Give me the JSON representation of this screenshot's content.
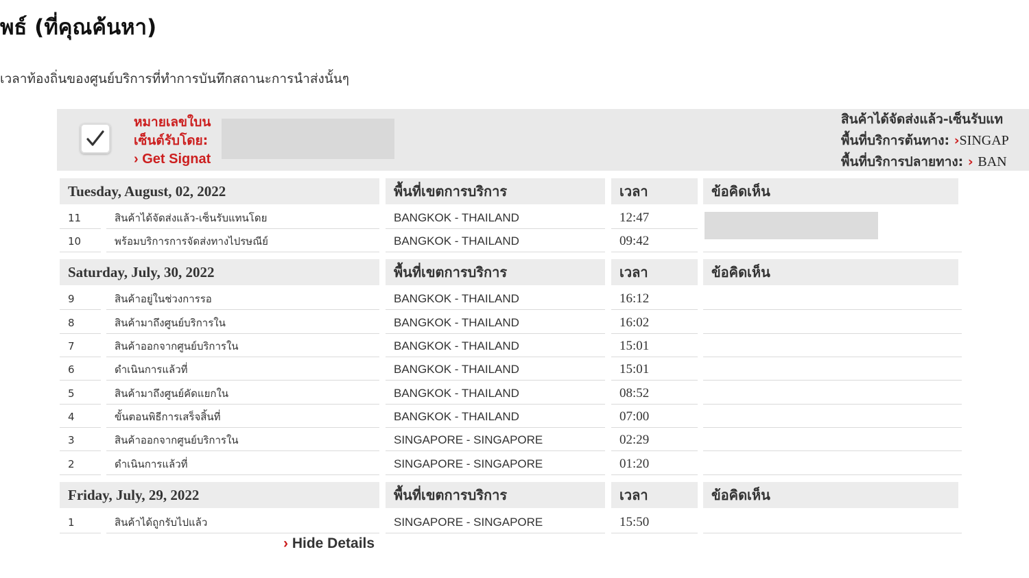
{
  "page": {
    "title": "พธ์ (ที่คุณค้นหา)",
    "subtitle": "เวลาท้องถิ่นของศูนย์บริการที่ทำการบันทึกสถานะการนำส่งนั้นๆ"
  },
  "summary": {
    "waybill_label": "หมายเลขใบน",
    "signed_by_label": "เซ็นต์รับโดย:",
    "signature_link": "Get Signat",
    "status_text": "สินค้าได้จัดส่งแล้ว-เซ็นรับแท",
    "origin_label": "พื้นที่บริการต้นทาง:",
    "origin_value": "SINGAP",
    "destination_label": "พื้นที่บริการปลายทาง:",
    "destination_value": "BAN",
    "colors": {
      "accent_red": "#cc1f1f",
      "header_gray": "#ececec",
      "summary_gray": "#e9e9e9"
    },
    "icons": [
      "checkmark-icon",
      "arrow-right-icon"
    ]
  },
  "table": {
    "headers": {
      "location": "พื้นที่เขตการบริการ",
      "time": "เวลา",
      "comments": "ข้อคิดเห็น"
    },
    "groups": [
      {
        "date": "Tuesday, August, 02, 2022",
        "events": [
          {
            "no": "11",
            "desc": "สินค้าได้จัดส่งแล้ว-เซ็นรับแทนโดย",
            "location": "BANGKOK - THAILAND",
            "time": "12:47"
          },
          {
            "no": "10",
            "desc": "พร้อมบริการการจัดส่งทางไปรษณีย์",
            "location": "BANGKOK - THAILAND",
            "time": "09:42"
          }
        ]
      },
      {
        "date": "Saturday, July, 30, 2022",
        "events": [
          {
            "no": "9",
            "desc": "สินค้าอยู่ในช่วงการรอ",
            "location": "BANGKOK - THAILAND",
            "time": "16:12"
          },
          {
            "no": "8",
            "desc": "สินค้ามาถึงศูนย์บริการใน",
            "location": "BANGKOK - THAILAND",
            "time": "16:02"
          },
          {
            "no": "7",
            "desc": "สินค้าออกจากศูนย์บริการใน",
            "location": "BANGKOK - THAILAND",
            "time": "15:01"
          },
          {
            "no": "6",
            "desc": "ดำเนินการแล้วที่",
            "location": "BANGKOK - THAILAND",
            "time": "15:01"
          },
          {
            "no": "5",
            "desc": "สินค้ามาถึงศูนย์คัดแยกใน",
            "location": "BANGKOK - THAILAND",
            "time": "08:52"
          },
          {
            "no": "4",
            "desc": "ขั้นตอนพิธีการเสร็จสิ้นที่",
            "location": "BANGKOK - THAILAND",
            "time": "07:00"
          },
          {
            "no": "3",
            "desc": "สินค้าออกจากศูนย์บริการใน",
            "location": "SINGAPORE - SINGAPORE",
            "time": "02:29"
          },
          {
            "no": "2",
            "desc": "ดำเนินการแล้วที่",
            "location": "SINGAPORE - SINGAPORE",
            "time": "01:20"
          }
        ]
      },
      {
        "date": "Friday, July, 29, 2022",
        "events": [
          {
            "no": "1",
            "desc": "สินค้าได้ถูกรับไปแล้ว",
            "location": "SINGAPORE - SINGAPORE",
            "time": "15:50"
          }
        ]
      }
    ]
  },
  "footer": {
    "hide_details": "Hide Details"
  }
}
